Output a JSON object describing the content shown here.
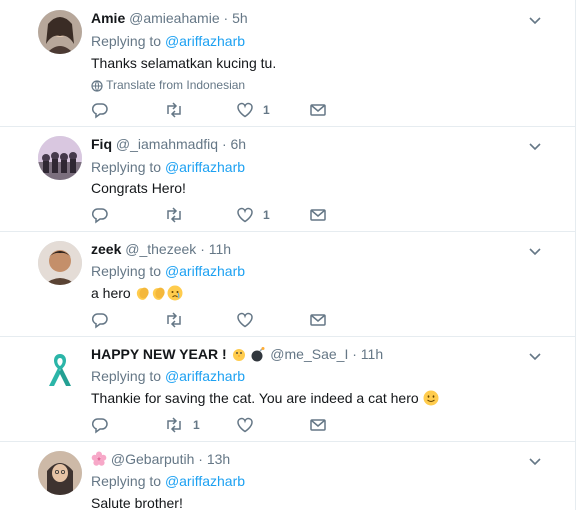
{
  "tweets": [
    {
      "name": "Amie",
      "handle": "@amieahamie",
      "time": "5h",
      "replying_prefix": "Replying to",
      "replying_to": "@ariffazharb",
      "text": "Thanks selamatkan kucing tu.",
      "translate": "Translate from Indonesian",
      "retweets": "",
      "likes": "1",
      "avatar_colors": [
        "#b7a79a",
        "#3a2c25"
      ]
    },
    {
      "name": "Fiq",
      "handle": "@_iamahmadfiq",
      "time": "6h",
      "replying_prefix": "Replying to",
      "replying_to": "@ariffazharb",
      "text": "Congrats Hero!",
      "retweets": "",
      "likes": "1",
      "avatar_colors": [
        "#d9c7e0",
        "#463a4c"
      ]
    },
    {
      "name": "zeek",
      "handle": "@_thezeek",
      "time": "11h",
      "replying_prefix": "Replying to",
      "replying_to": "@ariffazharb",
      "text": "a hero",
      "text_emojis": [
        "clapping-hands",
        "clapping-hands",
        "crying-face"
      ],
      "retweets": "",
      "likes": "",
      "avatar_colors": [
        "#e8c9a8",
        "#5a4334"
      ]
    },
    {
      "name": "HAPPY NEW YEAR !",
      "name_emojis": [
        "baby-chick",
        "bomb"
      ],
      "handle": "@me_Sae_I",
      "time": "11h",
      "replying_prefix": "Replying to",
      "replying_to": "@ariffazharb",
      "text": "Thankie for saving the cat. You are indeed a cat hero",
      "text_emojis": [
        "slightly-smiling-face"
      ],
      "retweets": "1",
      "likes": "",
      "avatar_colors": [
        "#ffffff",
        "#2bb5a8"
      ]
    },
    {
      "name": "",
      "name_emojis": [
        "cherry-blossom"
      ],
      "handle": "@Gebarputih",
      "time": "13h",
      "replying_prefix": "Replying to",
      "replying_to": "@ariffazharb",
      "text": "Salute brother!",
      "retweets": "",
      "likes": "",
      "avatar_colors": [
        "#cdb9a7",
        "#3e3330"
      ]
    }
  ],
  "colors": {
    "link": "#1da1f2",
    "muted": "#657786",
    "text": "#14171a",
    "divider": "#e6ecf0"
  }
}
